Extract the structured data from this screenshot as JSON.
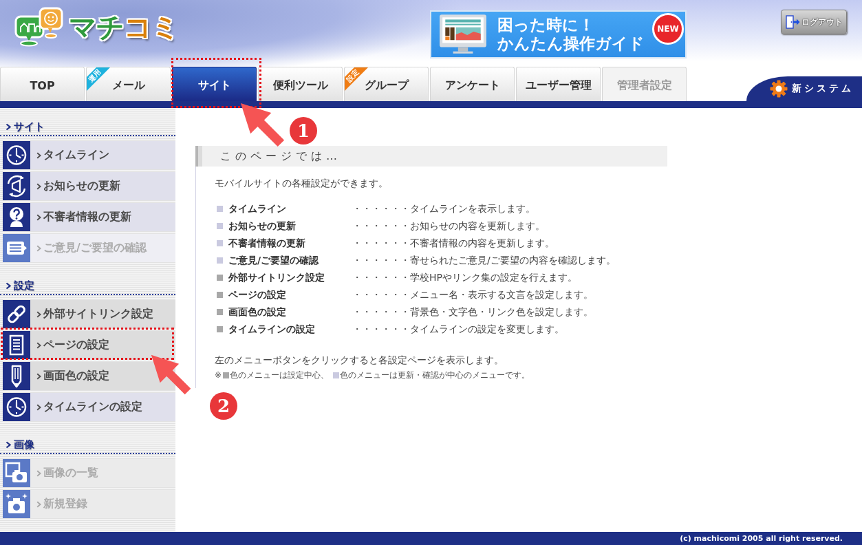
{
  "header": {
    "logo": {
      "parts": [
        "マチ",
        "コミ"
      ]
    },
    "banner": {
      "line_1": "困った時に！",
      "line_2": "かんたん操作ガイド",
      "badge": "NEW"
    },
    "logout_button": "ログアウト"
  },
  "tabs": [
    {
      "label": "TOP",
      "selected": false,
      "disabled": false
    },
    {
      "label": "メール",
      "selected": false,
      "disabled": false,
      "ribbon": {
        "text": "運用",
        "color": "#1db2de"
      }
    },
    {
      "label": "サイト",
      "selected": true,
      "disabled": false
    },
    {
      "label": "便利ツール",
      "selected": false,
      "disabled": false
    },
    {
      "label": "グループ",
      "selected": false,
      "disabled": false,
      "ribbon": {
        "text": "設定",
        "color": "#f07d14"
      }
    },
    {
      "label": "アンケート",
      "selected": false,
      "disabled": false
    },
    {
      "label": "ユーザー管理",
      "selected": false,
      "disabled": false
    },
    {
      "label": "管理者設定",
      "selected": false,
      "disabled": true
    }
  ],
  "new_system_link": "新システム",
  "sidebar": {
    "sections": [
      {
        "title": "サイト",
        "items": [
          {
            "label": "タイムライン",
            "kind": "clock",
            "color": "#e0e0ec",
            "disabled": false
          },
          {
            "label": "お知らせの更新",
            "kind": "megaphone",
            "color": "#e0e0ec",
            "disabled": false
          },
          {
            "label": "不審者情報の更新",
            "kind": "question",
            "color": "#e0e0ec",
            "disabled": false
          },
          {
            "label": "ご意見/ご要望の確認",
            "kind": "comment",
            "color": "#eeeef4",
            "disabled": true
          }
        ]
      },
      {
        "title": "設定",
        "items": [
          {
            "label": "外部サイトリンク設定",
            "kind": "link",
            "color": "#dddddd",
            "disabled": false
          },
          {
            "label": "ページの設定",
            "kind": "document",
            "color": "#dddddd",
            "disabled": false
          },
          {
            "label": "画面色の設定",
            "kind": "pencil",
            "color": "#dddddd",
            "disabled": false
          },
          {
            "label": "タイムラインの設定",
            "kind": "clock",
            "color": "#e0e0ec",
            "disabled": false
          }
        ]
      },
      {
        "title": "画像",
        "items": [
          {
            "label": "画像の一覧",
            "kind": "photos",
            "color": "#ebebeb",
            "disabled": true
          },
          {
            "label": "新規登録",
            "kind": "camera",
            "color": "#ebebeb",
            "disabled": true
          }
        ]
      }
    ]
  },
  "content": {
    "heading": "このページでは…",
    "intro": "モバイルサイトの各種設定ができます。",
    "list": [
      {
        "name": "タイムライン",
        "leader": "・・・・・・",
        "description": "タイムラインを表示します。",
        "color": "#cacae0"
      },
      {
        "name": "お知らせの更新",
        "leader": "・・・・・・",
        "description": "お知らせの内容を更新します。",
        "color": "#cacae0"
      },
      {
        "name": "不審者情報の更新",
        "leader": "・・・・・・",
        "description": "不審者情報の内容を更新します。",
        "color": "#cacae0"
      },
      {
        "name": "ご意見/ご要望の確認",
        "leader": "・・・・・・",
        "description": "寄せられたご意見/ご要望の内容を確認します。",
        "color": "#cacae0"
      },
      {
        "name": "外部サイトリンク設定",
        "leader": "・・・・・・",
        "description": "学校HPやリンク集の設定を行えます。",
        "color": "#a8a8a8"
      },
      {
        "name": "ページの設定",
        "leader": "・・・・・・",
        "description": "メニュー名・表示する文言を設定します。",
        "color": "#a8a8a8"
      },
      {
        "name": "画面色の設定",
        "leader": "・・・・・・",
        "description": "背景色・文字色・リンク色を設定します。",
        "color": "#a8a8a8"
      },
      {
        "name": "タイムラインの設定",
        "leader": "・・・・・・",
        "description": "タイムラインの設定を変更します。",
        "color": "#a8a8a8"
      }
    ],
    "instruction": "左のメニューボタンをクリックすると各設定ページを表示します。",
    "note": {
      "prefix": "※",
      "legend": [
        {
          "color": "#a8a8a8",
          "text": "色のメニューは設定中心、"
        },
        {
          "color": "#cacae0",
          "text": "色のメニューは更新・確認が中心のメニューです。"
        }
      ]
    }
  },
  "annotations": [
    {
      "number": "1"
    },
    {
      "number": "2"
    }
  ],
  "footer": {
    "copyright": "(c) machicomi 2005 all right reserved."
  }
}
